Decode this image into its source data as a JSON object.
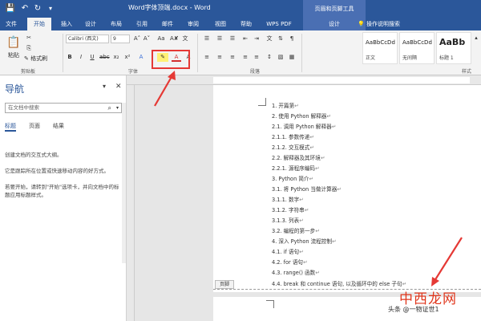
{
  "titlebar": {
    "title": "Word字体顶端.docx - Word",
    "context_title": "页眉和页脚工具",
    "save_icon": "save-icon",
    "undo_icon": "undo-icon",
    "redo_icon": "redo-icon"
  },
  "tabs": [
    {
      "label": "文件"
    },
    {
      "label": "开始"
    },
    {
      "label": "插入"
    },
    {
      "label": "设计"
    },
    {
      "label": "布局"
    },
    {
      "label": "引用"
    },
    {
      "label": "邮件"
    },
    {
      "label": "审阅"
    },
    {
      "label": "视图"
    },
    {
      "label": "帮助"
    },
    {
      "label": "WPS PDF"
    },
    {
      "label": "设计"
    }
  ],
  "tell_me": "操作说明搜索",
  "ribbon": {
    "paste_label": "粘贴",
    "clipboard_label": "剪贴板",
    "format_painter": "格式刷",
    "font_name": "Calibri (西文)",
    "font_size": "9",
    "font_group_label": "字体",
    "paragraph_group_label": "段落",
    "styles_group_label": "样式",
    "bold": "B",
    "italic": "I",
    "underline": "U",
    "font_color_glyph": "A",
    "styles": [
      {
        "preview": "AaBbCcDd",
        "label": "正文"
      },
      {
        "preview": "AaBbCcDd",
        "label": "无间隔"
      },
      {
        "preview": "AaBb",
        "label": "标题 1"
      }
    ]
  },
  "nav": {
    "title": "导航",
    "search_placeholder": "在文档中搜索",
    "tabs": [
      "标题",
      "页面",
      "结果"
    ],
    "messages": [
      "创建文档的交互式大纲。",
      "它是跟踪所在位置或快速移动内容的好方式。",
      "若要开始，请转到\"开始\"选项卡，并向文档中的标题应用标题样式。"
    ]
  },
  "document": {
    "lines": [
      "1. 开篇第",
      "2. 使用 Python 解释器",
      "2.1. 调用 Python 解释器",
      "2.1.1. 参数传递",
      "2.1.2. 交互模式",
      "2.2. 解释器及其环境",
      "2.2.1. 源程序编码",
      "3. Python 简介",
      "3.1. 将 Python 当做计算器",
      "3.1.1. 数字",
      "3.1.2. 字符串",
      "3.1.3. 列表",
      "3.2. 编程的第一步",
      "4. 深入 Python 流程控制",
      "4.1. if 语句",
      "4.2. for 语句",
      "4.3. range() 函数",
      "4.4. break 和 continue 语句, 以及循环中的 else 子句"
    ],
    "footer_tag": "页脚"
  },
  "watermark": {
    "main": "中西龙网",
    "sub": "头条 @一物证世1"
  },
  "colors": {
    "word_blue": "#2b579a",
    "highlight_red": "#e53935"
  }
}
